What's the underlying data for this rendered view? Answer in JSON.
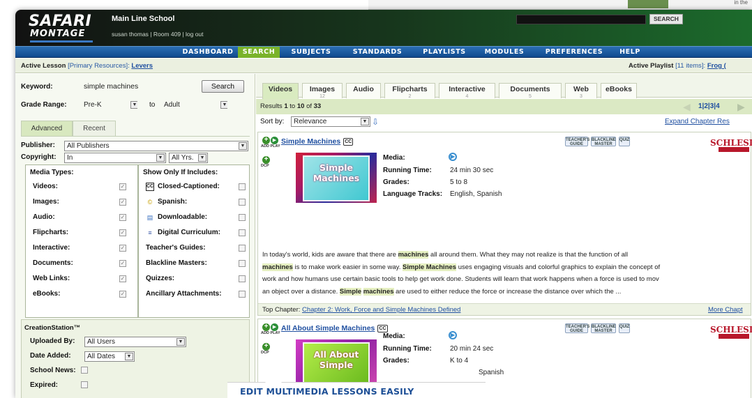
{
  "top_deco": {
    "text": "in\nthe"
  },
  "header": {
    "logo_top": "SAFARI",
    "logo_bottom": "MONTAGE",
    "school": "Main Line School",
    "user": "susan thomas | Room 409 | log out",
    "search_button": "SEARCH"
  },
  "nav": {
    "items": [
      "DASHBOARD",
      "SEARCH",
      "SUBJECTS",
      "STANDARDS",
      "PLAYLISTS",
      "MODULES",
      "PREFERENCES",
      "HELP"
    ],
    "active": "SEARCH",
    "active_color": "#7ab32a"
  },
  "active_bar": {
    "lesson_label": "Active Lesson",
    "lesson_bracket": "[Primary Resources]:",
    "lesson_name": "Levers",
    "playlist_label": "Active Playlist",
    "playlist_bracket": "[11 items]:",
    "playlist_name": "Frog ("
  },
  "search": {
    "keyword_label": "Keyword:",
    "keyword_value": "simple machines",
    "search_button": "Search",
    "grade_label": "Grade Range:",
    "grade_from": "Pre-K",
    "grade_to_label": "to",
    "grade_to": "Adult"
  },
  "subtabs": [
    "Advanced",
    "Recent"
  ],
  "filters": {
    "publisher_label": "Publisher:",
    "publisher_value": "All Publishers",
    "copyright_label": "Copyright:",
    "copyright_value": "In",
    "copyright_years": "All Yrs."
  },
  "media_types": {
    "heading": "Media Types:",
    "items": [
      "Videos:",
      "Images:",
      "Audio:",
      "Flipcharts:",
      "Interactive:",
      "Documents:",
      "Web Links:",
      "eBooks:"
    ]
  },
  "show_only": {
    "heading": "Show Only If Includes:",
    "items": [
      "Closed-Captioned:",
      "Spanish:",
      "Downloadable:",
      "Digital Curriculum:",
      "Teacher's Guides:",
      "Blackline Masters:",
      "Quizzes:",
      "Ancillary Attachments:"
    ],
    "icons": [
      "cc-icon",
      "spanish-icon",
      "download-icon",
      "digital-curriculum-icon"
    ]
  },
  "creation": {
    "heading": "CreationStation™",
    "uploaded_label": "Uploaded By:",
    "uploaded_value": "All Users",
    "date_label": "Date Added:",
    "date_value": "All Dates",
    "news_label": "School News:",
    "expired_label": "Expired:"
  },
  "media_tabs": [
    {
      "name": "Videos",
      "count": ""
    },
    {
      "name": "Images",
      "count": "12"
    },
    {
      "name": "Audio",
      "count": ""
    },
    {
      "name": "Flipcharts",
      "count": "2"
    },
    {
      "name": "Interactive",
      "count": "4"
    },
    {
      "name": "Documents",
      "count": "5"
    },
    {
      "name": "Web",
      "count": "3"
    },
    {
      "name": "eBooks",
      "count": ""
    }
  ],
  "results": {
    "prefix": "Results",
    "from": "1",
    "to_word": "to",
    "to": "10",
    "of_word": "of",
    "total": "33",
    "pages": "1|2|3|4",
    "sort_label": "Sort by:",
    "sort_value": "Relevance",
    "expand_link": "Expand Chapter Res"
  },
  "icon_labels": {
    "add_play": "ADD PLAY",
    "dcp": "DCP"
  },
  "badges": {
    "teacher": "TEACHER'S\nGUIDE",
    "blackline": "BLACKLINE\nMASTER",
    "quiz": "QUIZ"
  },
  "publisher_logo": "SCHLESINGER",
  "meta_labels": {
    "media": "Media:",
    "running": "Running Time:",
    "grades": "Grades:",
    "languages": "Language Tracks:"
  },
  "items": [
    {
      "title": "Simple Machines",
      "thumb_text": "Simple Machines",
      "running": "24 min 30 sec",
      "grades": "5 to 8",
      "languages": "English, Spanish",
      "desc_lines": [
        [
          "In today's world, kids are aware that there are ",
          "machines",
          " all around them. What they may not realize is that the function of all"
        ],
        [
          "",
          "machines",
          " is to make work easier in some way. ",
          "Simple Machines",
          " uses engaging visuals and colorful graphics to explain the concept of"
        ],
        [
          "work and how humans use certain basic tools to help get work done. Students will learn that work happens when a force is used to mov"
        ],
        [
          "an object over a distance. ",
          "Simple",
          " ",
          "machines",
          " are used to either reduce the force or increase the distance over which the ..."
        ]
      ],
      "top_chapter_label": "Top Chapter:",
      "top_chapter": "Chapter 2: Work, Force and Simple Machines Defined",
      "more": "More Chapt"
    },
    {
      "title": "All About Simple Machines",
      "thumb_text": "All About Simple",
      "running": "20 min 24 sec",
      "grades": "K to 4",
      "languages": "Spanish"
    }
  ],
  "callout": "EDIT MULTIMEDIA LESSONS EASILY"
}
